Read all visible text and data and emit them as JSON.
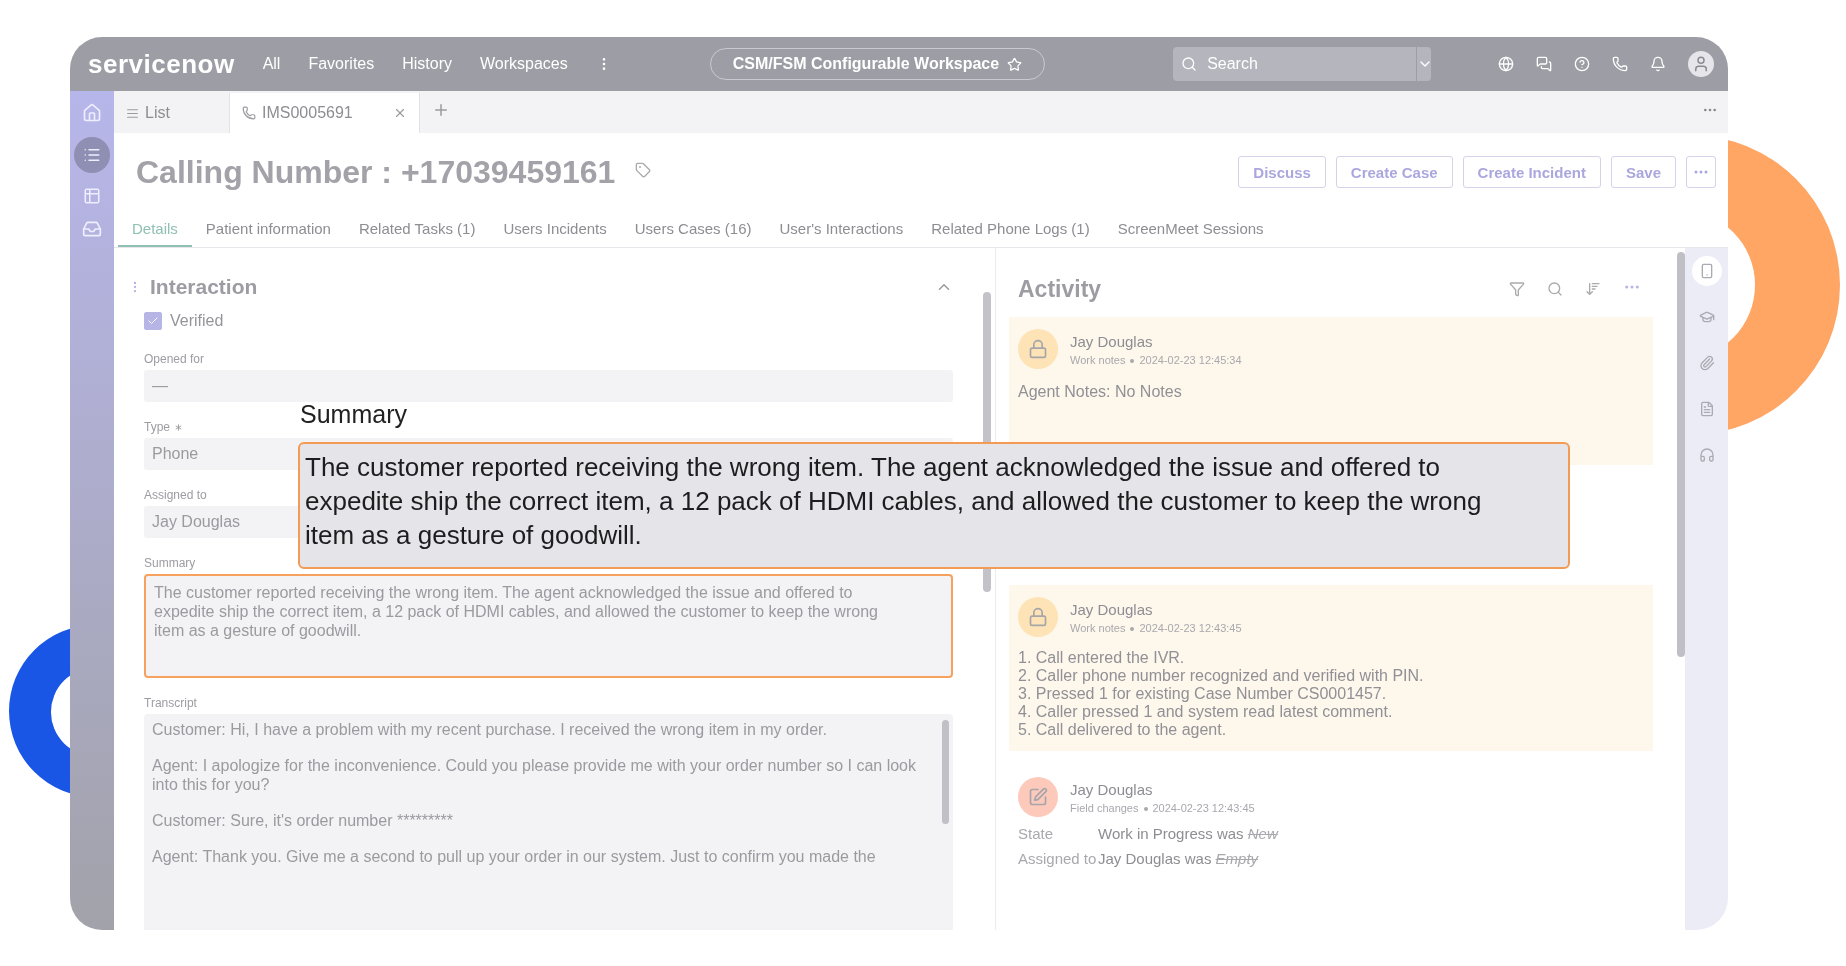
{
  "topbar": {
    "logo": "servicenow",
    "nav": [
      "All",
      "Favorites",
      "History",
      "Workspaces"
    ],
    "workspace": "CSM/FSM Configurable Workspace",
    "search": {
      "placeholder": "Search"
    }
  },
  "doc_tabs": [
    {
      "label": "List",
      "selected": false,
      "kind": "list"
    },
    {
      "label": "IMS0005691",
      "selected": true,
      "kind": "record"
    }
  ],
  "header": {
    "title": "Calling Number : +17039459161",
    "buttons": [
      "Discuss",
      "Create Case",
      "Create Incident",
      "Save"
    ]
  },
  "tabs": [
    {
      "label": "Details",
      "selected": true
    },
    {
      "label": "Patient information",
      "selected": false
    },
    {
      "label": "Related Tasks (1)",
      "selected": false
    },
    {
      "label": "Users Incidents",
      "selected": false
    },
    {
      "label": "Users Cases (16)",
      "selected": false
    },
    {
      "label": "User's Interactions",
      "selected": false
    },
    {
      "label": "Related Phone Logs (1)",
      "selected": false
    },
    {
      "label": "ScreenMeet Sessions",
      "selected": false
    }
  ],
  "form": {
    "section": "Interaction",
    "verified": {
      "label": "Verified",
      "checked": true
    },
    "fields": [
      {
        "label": "Opened for",
        "value": "—",
        "required": false
      },
      {
        "label": "Type",
        "value": "Phone",
        "required": true
      },
      {
        "label": "Assigned to",
        "value": "Jay Douglas",
        "required": false
      }
    ],
    "summary": {
      "label": "Summary",
      "value": "The customer reported receiving the wrong item. The agent acknowledged the issue and offered to expedite ship the correct item, a 12 pack of HDMI cables, and allowed the customer to keep the wrong item as a gesture of goodwill.",
      "focused": true
    },
    "transcript": {
      "label": "Transcript",
      "paragraphs": [
        "Customer: Hi, I have a problem with my recent purchase. I received the wrong item in my order.",
        "Agent: I apologize for the inconvenience. Could you please provide me with your order number so I can look into this for you?",
        "Customer: Sure, it's order number *********",
        "Agent: Thank you. Give me a second to pull up your order in our system. Just to confirm you made the"
      ]
    }
  },
  "activity": {
    "title": "Activity",
    "entries": [
      {
        "kind": "work_notes",
        "author": "Jay Douglas",
        "type": "Work notes",
        "time": "2024-02-23 12:45:34",
        "lines": [
          "Agent Notes: No Notes"
        ]
      },
      {
        "kind": "work_notes",
        "author": "Jay Douglas",
        "type": "Work notes",
        "time": "2024-02-23 12:43:45",
        "lines": [
          "1. Call entered the IVR.",
          "2. Caller phone number recognized and verified with PIN.",
          "3. Pressed 1 for existing Case Number CS0001457.",
          "4. Caller pressed 1 and system read latest comment.",
          "5. Call delivered to the agent."
        ]
      },
      {
        "kind": "field_changes",
        "author": "Jay Douglas",
        "type": "Field changes",
        "time": "2024-02-23 12:43:45",
        "changes": [
          {
            "field": "State",
            "value": "Work in Progress was",
            "old": "New"
          },
          {
            "field": "Assigned to",
            "value": "Jay Douglas was",
            "old": "Empty"
          }
        ]
      }
    ]
  },
  "callout": {
    "label": "Summary",
    "text": "The customer reported receiving the wrong item. The agent acknowledged the issue and offered to expedite ship the correct item, a 12 pack of HDMI cables, and allowed the customer to keep the wrong item as a gesture of goodwill."
  }
}
